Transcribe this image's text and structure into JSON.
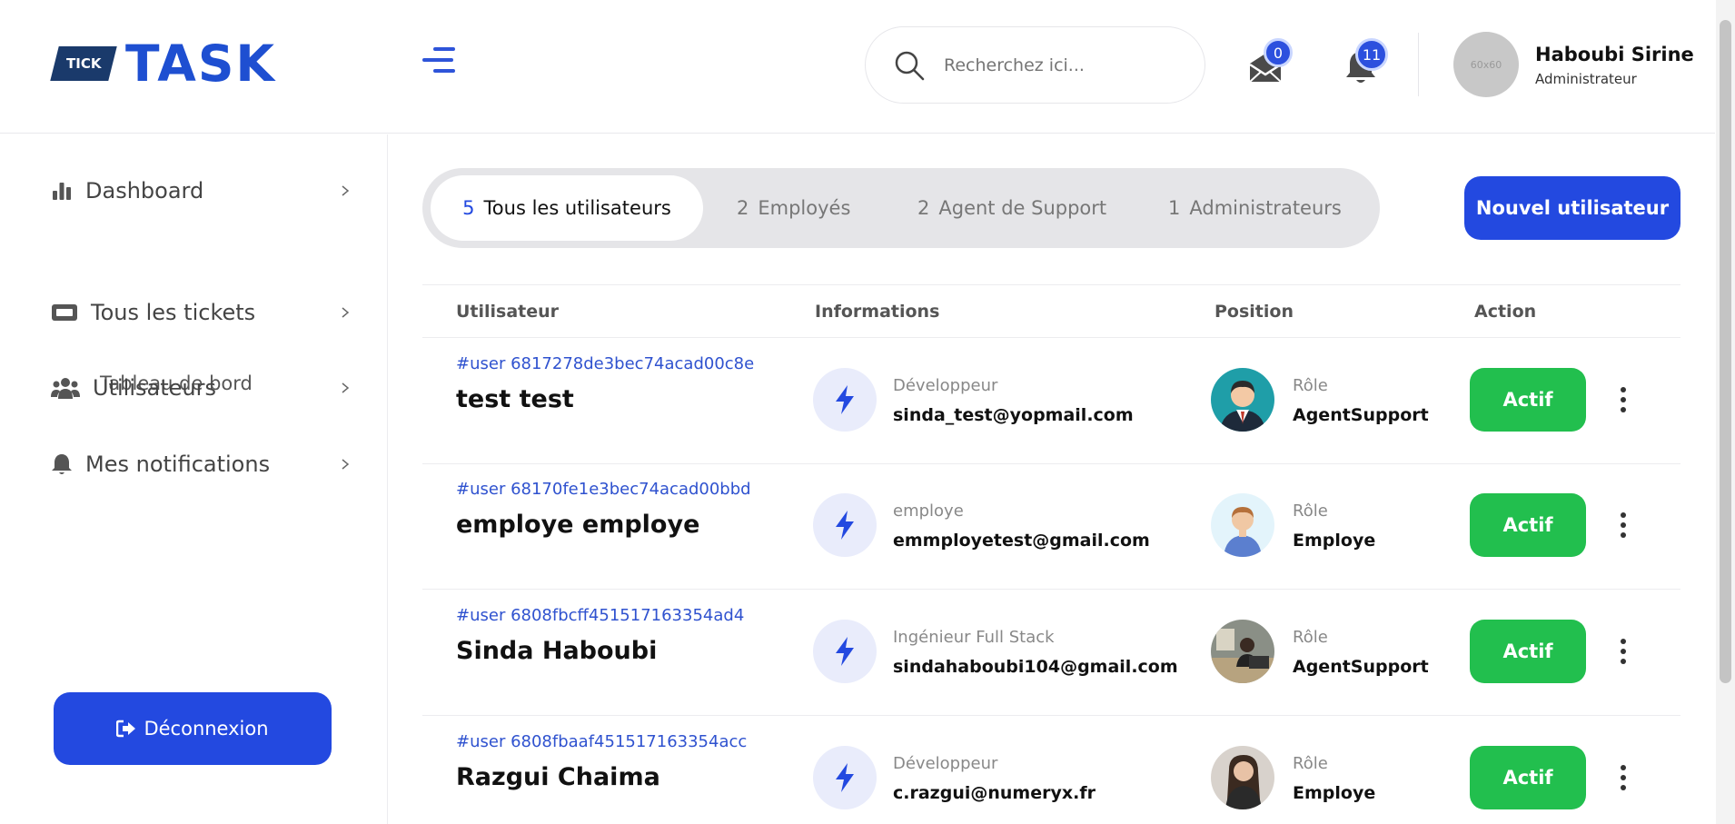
{
  "header": {
    "logo_badge": "TICK",
    "logo_text": "TASK",
    "search_placeholder": "Recherchez ici...",
    "messages_count": "0",
    "notifications_count": "11",
    "avatar_placeholder": "60x60",
    "user_name": "Haboubi Sirine",
    "user_role": "Administrateur"
  },
  "sidebar": {
    "dashboard": "Dashboard",
    "dashboard_sub": "Tableau de bord",
    "tickets": "Tous les tickets",
    "users": "Utilisateurs",
    "notifications": "Mes notifications",
    "logout": "Déconnexion"
  },
  "tabs": [
    {
      "count": "5",
      "label": "Tous les utilisateurs"
    },
    {
      "count": "2",
      "label": "Employés"
    },
    {
      "count": "2",
      "label": "Agent de Support"
    },
    {
      "count": "1",
      "label": "Administrateurs"
    }
  ],
  "new_user_button": "Nouvel utilisateur",
  "table": {
    "headers": {
      "user": "Utilisateur",
      "info": "Informations",
      "position": "Position",
      "action": "Action"
    },
    "rows": [
      {
        "id": "#user 6817278de3bec74acad00c8e",
        "name": "test test",
        "job": "Développeur",
        "email": "sinda_test@yopmail.com",
        "role_label": "Rôle",
        "role": "AgentSupport",
        "status": "Actif"
      },
      {
        "id": "#user 68170fe1e3bec74acad00bbd",
        "name": "employe employe",
        "job": "employe",
        "email": "emmployetest@gmail.com",
        "role_label": "Rôle",
        "role": "Employe",
        "status": "Actif"
      },
      {
        "id": "#user 6808fbcff451517163354ad4",
        "name": "Sinda Haboubi",
        "job": "Ingénieur Full Stack",
        "email": "sindahaboubi104@gmail.com",
        "role_label": "Rôle",
        "role": "AgentSupport",
        "status": "Actif"
      },
      {
        "id": "#user 6808fbaaf451517163354acc",
        "name": "Razgui Chaima",
        "job": "Développeur",
        "email": "c.razgui@numeryx.fr",
        "role_label": "Rôle",
        "role": "Employe",
        "status": "Actif"
      }
    ]
  },
  "colors": {
    "primary": "#2349e0",
    "success": "#22bf4e",
    "tab_bg": "#e5e5e8"
  }
}
